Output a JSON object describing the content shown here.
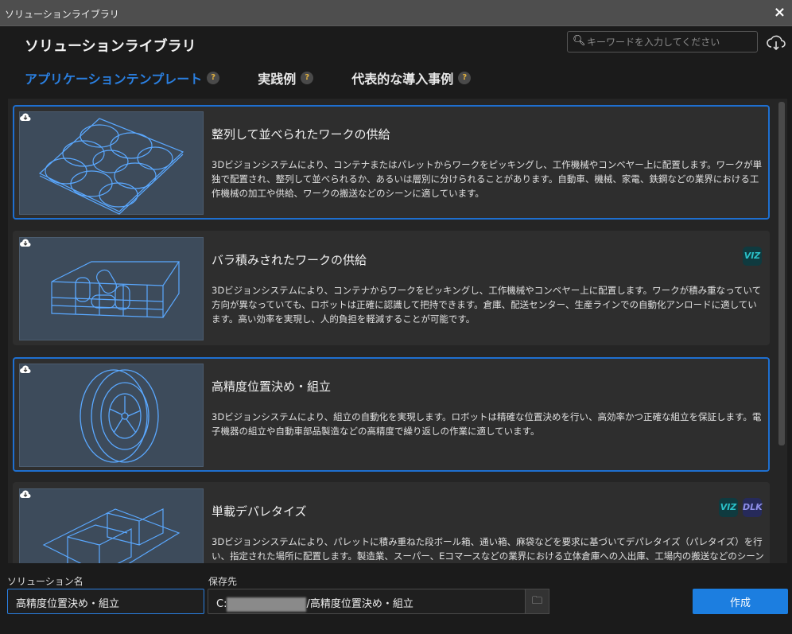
{
  "window": {
    "title": "ソリューションライブラリ",
    "close_icon": "×"
  },
  "header": {
    "title": "ソリューションライブラリ",
    "search_placeholder": "キーワードを入力してください",
    "help": "?"
  },
  "tabs": [
    {
      "label": "アプリケーションテンプレート"
    },
    {
      "label": "実践例"
    },
    {
      "label": "代表的な導入事例"
    }
  ],
  "cards": [
    {
      "title": "整列して並べられたワークの供給",
      "desc": "3Dビジョンシステムにより、コンテナまたはパレットからワークをピッキングし、工作機械やコンベヤー上に配置します。ワークが単独で配置され、整列して並べられるか、あるいは層別に分けられることがあります。自動車、機械、家電、鉄鋼などの業界における工作機械の加工や供給、ワークの搬送などのシーンに適しています。",
      "badges": []
    },
    {
      "title": "バラ積みされたワークの供給",
      "desc": "3Dビジョンシステムにより、コンテナからワークをピッキングし、工作機械やコンベヤー上に配置します。ワークが積み重なっていて方向が異なっていても、ロボットは正確に認識して把持できます。倉庫、配送センター、生産ラインでの自動化アンロードに適しています。高い効率を実現し、人的負担を軽減することが可能です。",
      "badges": [
        "VIZ"
      ]
    },
    {
      "title": "高精度位置決め・組立",
      "desc": "3Dビジョンシステムにより、組立の自動化を実現します。ロボットは精確な位置決めを行い、高効率かつ正確な組立を保証します。電子機器の組立や自動車部品製造などの高精度で繰り返しの作業に適しています。",
      "badges": []
    },
    {
      "title": "単載デパレタイズ",
      "desc": "3Dビジョンシステムにより、パレットに積み重ねた段ボール箱、通い箱、麻袋などを要求に基づいてデパレタイズ（パレタイズ）を行い、指定された場所に配置します。製造業、スーパー、Eコマースなどの業界における立体倉庫への入出庫、工場内の搬送などのシーンに適して",
      "badges": [
        "VIZ",
        "DLK"
      ]
    }
  ],
  "form": {
    "name_label": "ソリューション名",
    "name_value": "高精度位置決め・組立",
    "path_label": "保存先",
    "path_prefix": "C:",
    "path_suffix": "/高精度位置決め・組立",
    "create_label": "作成"
  },
  "colors": {
    "accent": "#1c7ee0",
    "thumb_bg": "#3d4b5b",
    "wire": "#5aa8ff"
  }
}
